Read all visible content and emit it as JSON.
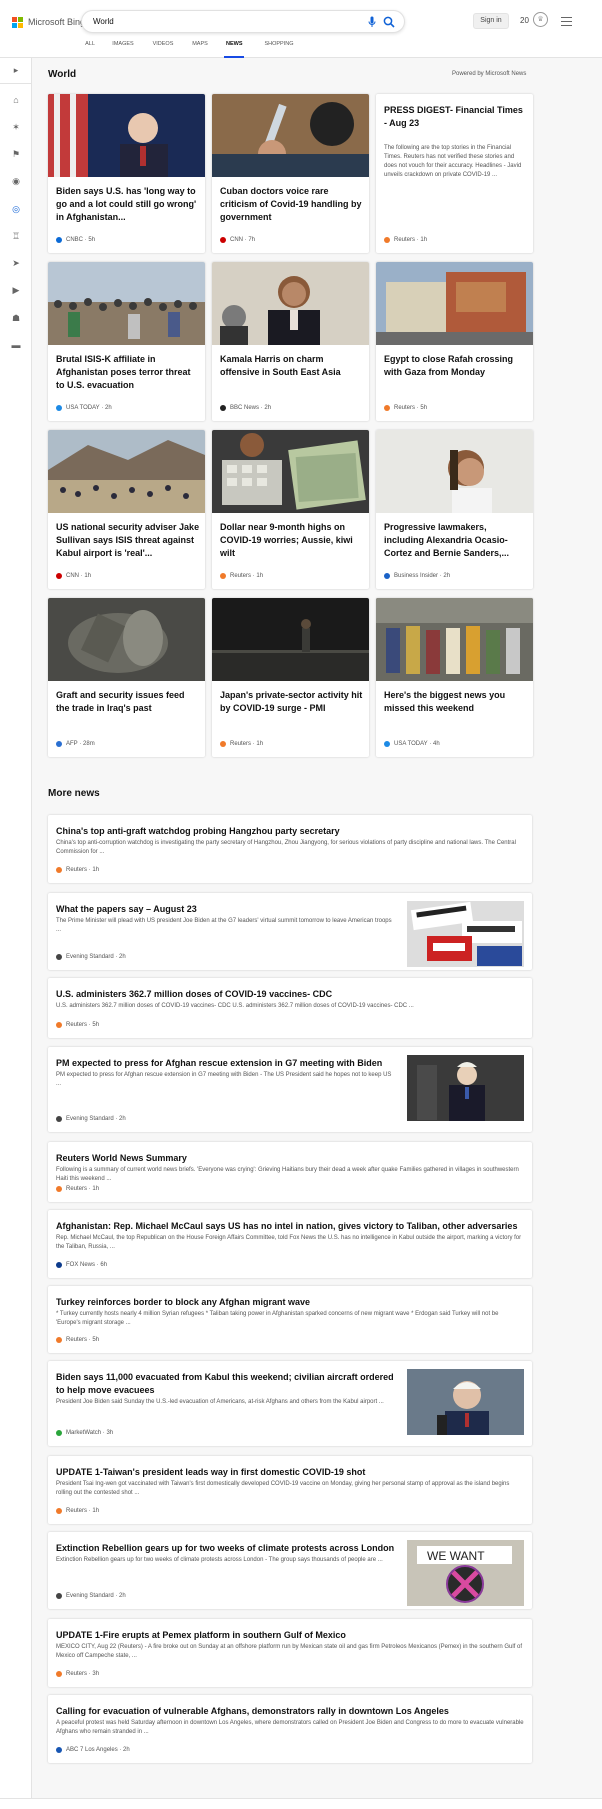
{
  "app": {
    "logo_text": "Microsoft Bing",
    "query": "World",
    "sign_in": "Sign in",
    "rewards_points": "20"
  },
  "tabs": [
    {
      "label": "ALL",
      "active": false
    },
    {
      "label": "IMAGES",
      "active": false
    },
    {
      "label": "VIDEOS",
      "active": false
    },
    {
      "label": "MAPS",
      "active": false
    },
    {
      "label": "NEWS",
      "active": true
    },
    {
      "label": "SHOPPING",
      "active": false
    }
  ],
  "sidebar": {
    "items": [
      "chevron-right-icon",
      "home-icon",
      "science-icon",
      "flag-icon",
      "pin-icon",
      "globe-icon",
      "trophy-icon",
      "rocket-icon",
      "video-icon",
      "bank-icon",
      "card-icon"
    ]
  },
  "section": {
    "title": "World",
    "powered_by": "Powered by Microsoft News"
  },
  "colors": {
    "accent": "#174ae4",
    "active_icon": "#1062d6"
  },
  "cards": [
    {
      "headline": "Biden says U.S. has 'long way to go and a lot could still go wrong' in Afghanistan...",
      "source": "CNBC",
      "time": "5h",
      "source_color": "#0b6ad6"
    },
    {
      "headline": "Cuban doctors voice rare criticism of Covid-19 handling by government",
      "source": "CNN",
      "time": "7h",
      "source_color": "#cc0000"
    },
    {
      "headline": "PRESS DIGEST- Financial Times - Aug 23",
      "desc": "The following are the top stories in the Financial Times. Reuters has not verified these stories and does not vouch for their accuracy. Headlines - Javid unveils crackdown on private COVID-19 ...",
      "source": "Reuters",
      "time": "1h",
      "source_color": "#f07a2a"
    },
    {
      "headline": "Brutal ISIS-K affiliate in Afghanistan poses terror threat to U.S. evacuation",
      "source": "USA TODAY",
      "time": "2h",
      "source_color": "#1d8ae5"
    },
    {
      "headline": "Kamala Harris on charm offensive in South East Asia",
      "source": "BBC News",
      "time": "2h",
      "source_color": "#222222"
    },
    {
      "headline": "Egypt to close Rafah crossing with Gaza from Monday",
      "source": "Reuters",
      "time": "5h",
      "source_color": "#f07a2a"
    },
    {
      "headline": "US national security adviser Jake Sullivan says ISIS threat against Kabul airport is 'real'...",
      "source": "CNN",
      "time": "1h",
      "source_color": "#cc0000"
    },
    {
      "headline": "Dollar near 9-month highs on COVID-19 worries; Aussie, kiwi wilt",
      "source": "Reuters",
      "time": "1h",
      "source_color": "#f07a2a"
    },
    {
      "headline": "Progressive lawmakers, including Alexandria Ocasio-Cortez and Bernie Sanders,...",
      "source": "Business Insider",
      "time": "2h",
      "source_color": "#1a62c7"
    },
    {
      "headline": "Graft and security issues feed the trade in Iraq's past",
      "source": "AFP",
      "time": "28m",
      "source_color": "#2a6fd1"
    },
    {
      "headline": "Japan's private-sector activity hit by COVID-19 surge - PMI",
      "source": "Reuters",
      "time": "1h",
      "source_color": "#f07a2a"
    },
    {
      "headline": "Here's the biggest news you missed this weekend",
      "source": "USA TODAY",
      "time": "4h",
      "source_color": "#1d8ae5"
    }
  ],
  "more_news": {
    "title": "More news",
    "items": [
      {
        "title": "China's top anti-graft watchdog probing Hangzhou party secretary",
        "desc": "China's top anti-corruption watchdog is investigating the party secretary of Hangzhou, Zhou Jiangyong, for serious violations of party discipline and national laws. The Central Commission for ...",
        "source": "Reuters",
        "time": "1h",
        "source_color": "#f07a2a"
      },
      {
        "title": "What the papers say – August 23",
        "desc": "The Prime Minister will plead with US president Joe Biden at the G7 leaders' virtual summit tomorrow to leave American troops ...",
        "source": "Evening Standard",
        "time": "2h",
        "source_color": "#444444"
      },
      {
        "title": "U.S. administers 362.7 million doses of COVID-19 vaccines- CDC",
        "desc": "U.S. administers 362.7 million doses of COVID-19 vaccines- CDC U.S. administers 362.7 million doses of COVID-19 vaccines- CDC ...",
        "source": "Reuters",
        "time": "5h",
        "source_color": "#f07a2a"
      },
      {
        "title": "PM expected to press for Afghan rescue extension in G7 meeting with Biden",
        "desc": "PM expected to press for Afghan rescue extension in G7 meeting with Biden - The US President said he hopes not to keep US ...",
        "source": "Evening Standard",
        "time": "2h",
        "source_color": "#444444"
      },
      {
        "title": "Reuters World News Summary",
        "desc": "Following is a summary of current world news briefs. 'Everyone was crying': Grieving Haitians bury their dead a week after quake Families gathered in villages in southwestern Haiti this weekend ...",
        "source": "Reuters",
        "time": "1h",
        "source_color": "#f07a2a"
      },
      {
        "title": "Afghanistan: Rep. Michael McCaul says US has no intel in nation, gives victory to Taliban, other adversaries",
        "desc": "Rep. Michael McCaul, the top Republican on the House Foreign Affairs Committee, told Fox News the U.S. has no intelligence in Kabul outside the airport, marking a victory for the Taliban, Russia, ...",
        "source": "FOX News",
        "time": "6h",
        "source_color": "#0d3b8c"
      },
      {
        "title": "Turkey reinforces border to block any Afghan migrant wave",
        "desc": "* Turkey currently hosts nearly 4 million Syrian refugees * Taliban taking power in Afghanistan sparked concerns of new migrant wave * Erdogan said Turkey will not be 'Europe's migrant storage ...",
        "source": "Reuters",
        "time": "5h",
        "source_color": "#f07a2a"
      },
      {
        "title": "Biden says 11,000 evacuated from Kabul this weekend; civilian aircraft ordered to help move evacuees",
        "desc": "President Joe Biden said Sunday the U.S.-led evacuation of Americans, at-risk Afghans and others from the Kabul airport ...",
        "source": "MarketWatch",
        "time": "3h",
        "source_color": "#2aa53b"
      },
      {
        "title": "UPDATE 1-Taiwan's president leads way in first domestic COVID-19 shot",
        "desc": "President Tsai Ing-wen got vaccinated with Taiwan's first domestically developed COVID-19 vaccine on Monday, giving her personal stamp of approval as the island begins rolling out the contested shot ...",
        "source": "Reuters",
        "time": "1h",
        "source_color": "#f07a2a"
      },
      {
        "title": "Extinction Rebellion gears up for two weeks of climate protests across London",
        "desc": "Extinction Rebellion gears up for two weeks of climate protests across London - The group says thousands of people are ...",
        "source": "Evening Standard",
        "time": "2h",
        "source_color": "#444444"
      },
      {
        "title": "UPDATE 1-Fire erupts at Pemex platform in southern Gulf of Mexico",
        "desc": "MEXICO CITY, Aug 22 (Reuters) - A fire broke out on Sunday at an offshore platform run by Mexican state oil and gas firm Petroleos Mexicanos (Pemex) in the southern Gulf of Mexico off Campeche state, ...",
        "source": "Reuters",
        "time": "3h",
        "source_color": "#f07a2a"
      },
      {
        "title": "Calling for evacuation of vulnerable Afghans, demonstrators rally in downtown Los Angeles",
        "desc": "A peaceful protest was held Saturday afternoon in downtown Los Angeles, where demonstrators called on President Joe Biden and Congress to do more to evacuate vulnerable Afghans who remain stranded in ...",
        "source": "ABC 7 Los Angeles",
        "time": "2h",
        "source_color": "#1856b3"
      }
    ]
  }
}
